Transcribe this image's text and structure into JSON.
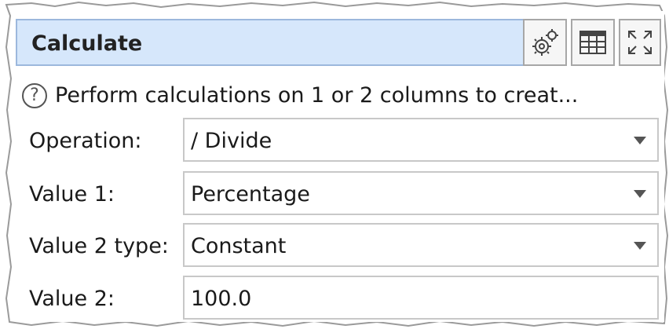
{
  "panel": {
    "title": "Calculate",
    "toolbar": {
      "settings_icon": "gears-icon",
      "table_icon": "table-icon",
      "maximize_icon": "expand-arrows-icon"
    },
    "help": {
      "icon": "question-circle-icon",
      "icon_glyph": "?",
      "text": "Perform calculations on 1 or 2 columns to creat..."
    },
    "fields": [
      {
        "label": "Operation:",
        "value": "/ Divide",
        "type": "dropdown"
      },
      {
        "label": "Value 1:",
        "value": "Percentage",
        "type": "dropdown"
      },
      {
        "label": "Value 2 type:",
        "value": "Constant",
        "type": "dropdown"
      },
      {
        "label": "Value 2:",
        "value": "100.0",
        "type": "text"
      }
    ]
  },
  "colors": {
    "title_bg": "#d6e7fb",
    "title_border": "#9cb8dd",
    "field_border": "#c8c8c8",
    "text": "#1a1a1a"
  }
}
